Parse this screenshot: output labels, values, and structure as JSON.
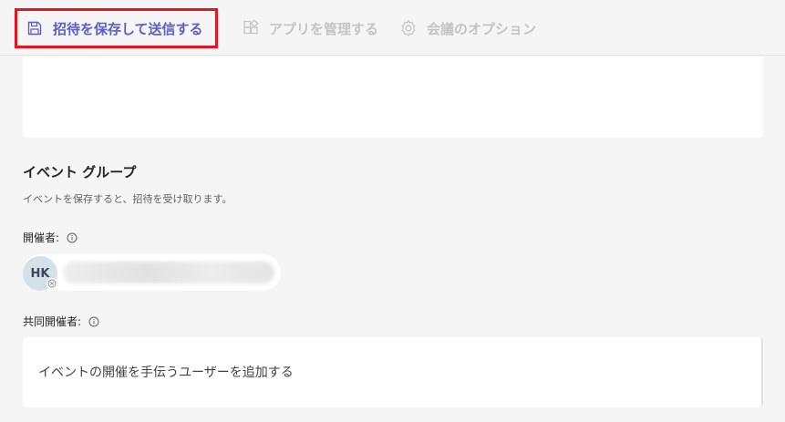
{
  "toolbar": {
    "save_label": "招待を保存して送信する",
    "apps_label": "アプリを管理する",
    "options_label": "会議のオプション",
    "save_icon": "save-icon",
    "apps_icon": "apps-icon",
    "options_icon": "gear-icon",
    "accent_color": "#5b5fc7",
    "highlight_color": "#e6141e"
  },
  "event_group": {
    "title": "イベント グループ",
    "description": "イベントを保存すると、招待を受け取ります。",
    "organizer_label": "開催者:",
    "organizer_initials": "HK",
    "coorganizer_label": "共同開催者:",
    "coorganizer_placeholder": "イベントの開催を手伝うユーザーを追加する"
  }
}
